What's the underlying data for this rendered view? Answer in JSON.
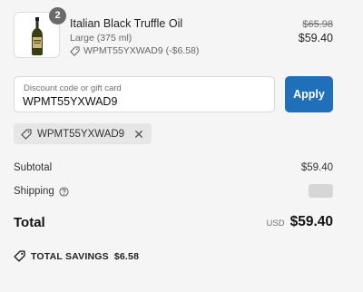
{
  "product": {
    "name": "Italian Black Truffle Oil",
    "variant": "Large (375 ml)",
    "discount_tag": "WPMT55YXWAD9 (-$6.58)",
    "quantity": "2",
    "compare_price": "$65.98",
    "price": "$59.40"
  },
  "discount_form": {
    "label": "Discount code or gift card",
    "value": "WPMT55YXWAD9",
    "apply_label": "Apply"
  },
  "applied_code": {
    "code": "WPMT55YXWAD9",
    "remove_symbol": "✕"
  },
  "summary": {
    "subtotal_label": "Subtotal",
    "subtotal_value": "$59.40",
    "shipping_label": "Shipping",
    "total_label": "Total",
    "currency": "USD",
    "total_value": "$59.40",
    "savings_label": "TOTAL SAVINGS",
    "savings_value": "$6.58"
  },
  "colors": {
    "accent": "#1f70b8",
    "background": "#f5f5f5"
  }
}
